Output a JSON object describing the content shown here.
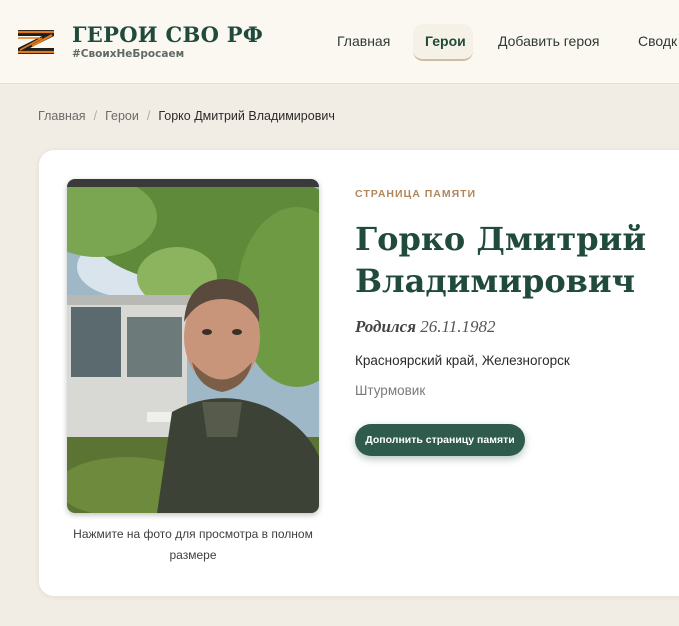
{
  "header": {
    "brand_title": "ГЕРОИ СВО РФ",
    "brand_tag": "#СвоихНеБросаем",
    "nav": [
      {
        "label": "Главная"
      },
      {
        "label": "Герои",
        "active": true
      },
      {
        "label": "Добавить героя"
      },
      {
        "label": "Сводк"
      }
    ]
  },
  "breadcrumb": {
    "items": [
      "Главная",
      "Герои"
    ],
    "current": "Горко Дмитрий Владимирович"
  },
  "hero": {
    "eyebrow": "СТРАНИЦА ПАМЯТИ",
    "name": "Горко Дмитрий Владимирович",
    "birth_label": "Родился",
    "birth_date": "26.11.1982",
    "location": "Красноярский край, Железногорск",
    "role": "Штурмовик",
    "cta_label": "Дополнить страницу памяти",
    "photo_caption": "Нажмите на фото для просмотра в полном размере"
  },
  "colors": {
    "accent": "#1f4a3c",
    "button": "#2e5b4b",
    "eyebrow": "#b0875a",
    "background": "#f2ede4"
  },
  "icons": {
    "logo": "orange-black-z-ribbon-icon"
  }
}
